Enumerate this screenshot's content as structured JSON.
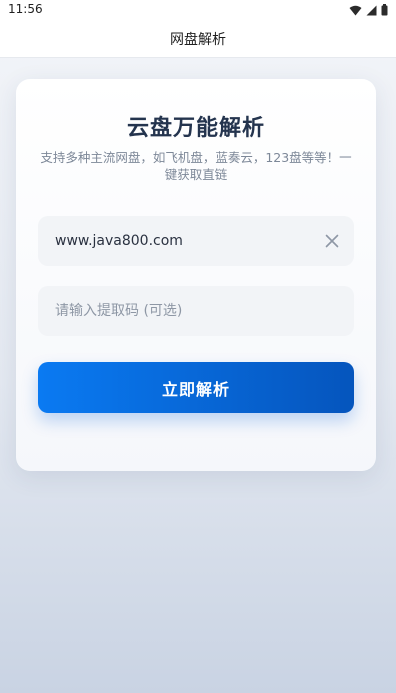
{
  "status_bar": {
    "time": "11:56",
    "icons": [
      "wifi-icon",
      "cellular-signal-icon",
      "battery-icon"
    ]
  },
  "app_bar": {
    "title": "网盘解析"
  },
  "card": {
    "title": "云盘万能解析",
    "subtitle": "支持多种主流网盘，如飞机盘，蓝奏云，123盘等等！一键获取直链",
    "url_input": {
      "value": "www.java800.com",
      "clear_icon": "close-icon"
    },
    "code_input": {
      "placeholder": "请输入提取码 (可选)"
    },
    "submit_label": "立即解析"
  },
  "colors": {
    "accent_start": "#0a7af2",
    "accent_end": "#0555bd",
    "title": "#24344e",
    "subtitle": "#7d8898"
  }
}
